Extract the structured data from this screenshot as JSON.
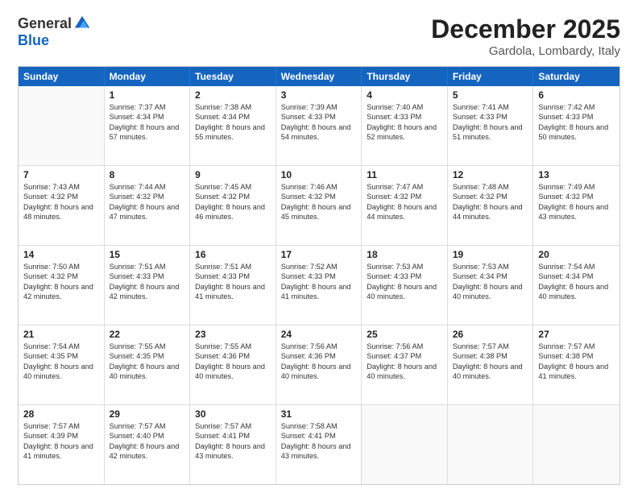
{
  "header": {
    "logo_general": "General",
    "logo_blue": "Blue",
    "month_title": "December 2025",
    "location": "Gardola, Lombardy, Italy"
  },
  "weekdays": [
    "Sunday",
    "Monday",
    "Tuesday",
    "Wednesday",
    "Thursday",
    "Friday",
    "Saturday"
  ],
  "rows": [
    [
      {
        "day": "",
        "empty": true
      },
      {
        "day": "1",
        "sunrise": "Sunrise: 7:37 AM",
        "sunset": "Sunset: 4:34 PM",
        "daylight": "Daylight: 8 hours and 57 minutes."
      },
      {
        "day": "2",
        "sunrise": "Sunrise: 7:38 AM",
        "sunset": "Sunset: 4:34 PM",
        "daylight": "Daylight: 8 hours and 55 minutes."
      },
      {
        "day": "3",
        "sunrise": "Sunrise: 7:39 AM",
        "sunset": "Sunset: 4:33 PM",
        "daylight": "Daylight: 8 hours and 54 minutes."
      },
      {
        "day": "4",
        "sunrise": "Sunrise: 7:40 AM",
        "sunset": "Sunset: 4:33 PM",
        "daylight": "Daylight: 8 hours and 52 minutes."
      },
      {
        "day": "5",
        "sunrise": "Sunrise: 7:41 AM",
        "sunset": "Sunset: 4:33 PM",
        "daylight": "Daylight: 8 hours and 51 minutes."
      },
      {
        "day": "6",
        "sunrise": "Sunrise: 7:42 AM",
        "sunset": "Sunset: 4:33 PM",
        "daylight": "Daylight: 8 hours and 50 minutes."
      }
    ],
    [
      {
        "day": "7",
        "sunrise": "Sunrise: 7:43 AM",
        "sunset": "Sunset: 4:32 PM",
        "daylight": "Daylight: 8 hours and 48 minutes."
      },
      {
        "day": "8",
        "sunrise": "Sunrise: 7:44 AM",
        "sunset": "Sunset: 4:32 PM",
        "daylight": "Daylight: 8 hours and 47 minutes."
      },
      {
        "day": "9",
        "sunrise": "Sunrise: 7:45 AM",
        "sunset": "Sunset: 4:32 PM",
        "daylight": "Daylight: 8 hours and 46 minutes."
      },
      {
        "day": "10",
        "sunrise": "Sunrise: 7:46 AM",
        "sunset": "Sunset: 4:32 PM",
        "daylight": "Daylight: 8 hours and 45 minutes."
      },
      {
        "day": "11",
        "sunrise": "Sunrise: 7:47 AM",
        "sunset": "Sunset: 4:32 PM",
        "daylight": "Daylight: 8 hours and 44 minutes."
      },
      {
        "day": "12",
        "sunrise": "Sunrise: 7:48 AM",
        "sunset": "Sunset: 4:32 PM",
        "daylight": "Daylight: 8 hours and 44 minutes."
      },
      {
        "day": "13",
        "sunrise": "Sunrise: 7:49 AM",
        "sunset": "Sunset: 4:32 PM",
        "daylight": "Daylight: 8 hours and 43 minutes."
      }
    ],
    [
      {
        "day": "14",
        "sunrise": "Sunrise: 7:50 AM",
        "sunset": "Sunset: 4:32 PM",
        "daylight": "Daylight: 8 hours and 42 minutes."
      },
      {
        "day": "15",
        "sunrise": "Sunrise: 7:51 AM",
        "sunset": "Sunset: 4:33 PM",
        "daylight": "Daylight: 8 hours and 42 minutes."
      },
      {
        "day": "16",
        "sunrise": "Sunrise: 7:51 AM",
        "sunset": "Sunset: 4:33 PM",
        "daylight": "Daylight: 8 hours and 41 minutes."
      },
      {
        "day": "17",
        "sunrise": "Sunrise: 7:52 AM",
        "sunset": "Sunset: 4:33 PM",
        "daylight": "Daylight: 8 hours and 41 minutes."
      },
      {
        "day": "18",
        "sunrise": "Sunrise: 7:53 AM",
        "sunset": "Sunset: 4:33 PM",
        "daylight": "Daylight: 8 hours and 40 minutes."
      },
      {
        "day": "19",
        "sunrise": "Sunrise: 7:53 AM",
        "sunset": "Sunset: 4:34 PM",
        "daylight": "Daylight: 8 hours and 40 minutes."
      },
      {
        "day": "20",
        "sunrise": "Sunrise: 7:54 AM",
        "sunset": "Sunset: 4:34 PM",
        "daylight": "Daylight: 8 hours and 40 minutes."
      }
    ],
    [
      {
        "day": "21",
        "sunrise": "Sunrise: 7:54 AM",
        "sunset": "Sunset: 4:35 PM",
        "daylight": "Daylight: 8 hours and 40 minutes."
      },
      {
        "day": "22",
        "sunrise": "Sunrise: 7:55 AM",
        "sunset": "Sunset: 4:35 PM",
        "daylight": "Daylight: 8 hours and 40 minutes."
      },
      {
        "day": "23",
        "sunrise": "Sunrise: 7:55 AM",
        "sunset": "Sunset: 4:36 PM",
        "daylight": "Daylight: 8 hours and 40 minutes."
      },
      {
        "day": "24",
        "sunrise": "Sunrise: 7:56 AM",
        "sunset": "Sunset: 4:36 PM",
        "daylight": "Daylight: 8 hours and 40 minutes."
      },
      {
        "day": "25",
        "sunrise": "Sunrise: 7:56 AM",
        "sunset": "Sunset: 4:37 PM",
        "daylight": "Daylight: 8 hours and 40 minutes."
      },
      {
        "day": "26",
        "sunrise": "Sunrise: 7:57 AM",
        "sunset": "Sunset: 4:38 PM",
        "daylight": "Daylight: 8 hours and 40 minutes."
      },
      {
        "day": "27",
        "sunrise": "Sunrise: 7:57 AM",
        "sunset": "Sunset: 4:38 PM",
        "daylight": "Daylight: 8 hours and 41 minutes."
      }
    ],
    [
      {
        "day": "28",
        "sunrise": "Sunrise: 7:57 AM",
        "sunset": "Sunset: 4:39 PM",
        "daylight": "Daylight: 8 hours and 41 minutes."
      },
      {
        "day": "29",
        "sunrise": "Sunrise: 7:57 AM",
        "sunset": "Sunset: 4:40 PM",
        "daylight": "Daylight: 8 hours and 42 minutes."
      },
      {
        "day": "30",
        "sunrise": "Sunrise: 7:57 AM",
        "sunset": "Sunset: 4:41 PM",
        "daylight": "Daylight: 8 hours and 43 minutes."
      },
      {
        "day": "31",
        "sunrise": "Sunrise: 7:58 AM",
        "sunset": "Sunset: 4:41 PM",
        "daylight": "Daylight: 8 hours and 43 minutes."
      },
      {
        "day": "",
        "empty": true
      },
      {
        "day": "",
        "empty": true
      },
      {
        "day": "",
        "empty": true
      }
    ]
  ]
}
